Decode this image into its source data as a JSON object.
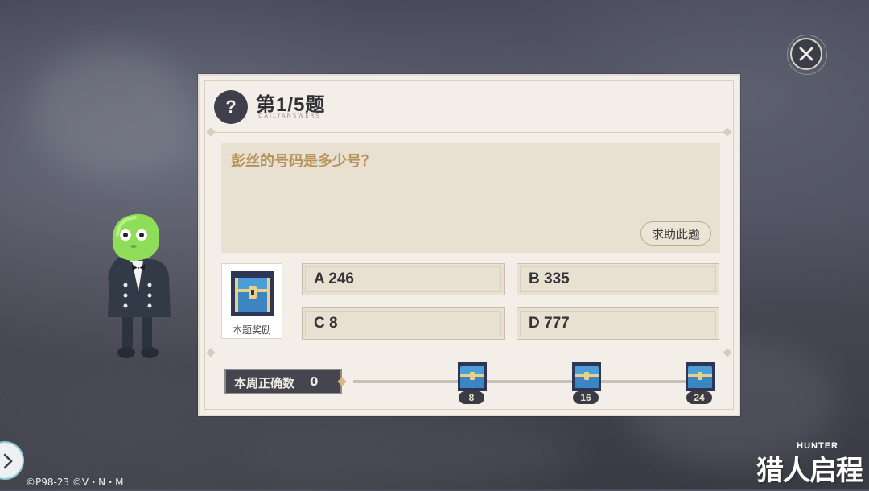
{
  "quiz": {
    "title": "第1/5题",
    "subtitle": "DAILYANSWERS",
    "question": "彭丝的号码是多少号？",
    "help_label": "求助此题",
    "reward_label": "本题奖励",
    "options": [
      {
        "label": "A 246"
      },
      {
        "label": "B 335"
      },
      {
        "label": "C 8"
      },
      {
        "label": "D 777"
      }
    ]
  },
  "progress": {
    "label": "本周正确数",
    "count": "0",
    "milestones": [
      {
        "value": "8"
      },
      {
        "value": "16"
      },
      {
        "value": "24"
      }
    ]
  },
  "footer": {
    "copyright": "©P98-23 ©V・N・M",
    "logo_en": "HUNTER",
    "logo_cn": "猎人启程"
  },
  "icons": {
    "close": "close-icon",
    "question": "question-mark-icon",
    "arrow": "chevron-right-icon",
    "chest": "treasure-chest-icon"
  },
  "colors": {
    "panel_bg": "#f3efe8",
    "question_text": "#b89258",
    "dark": "#3e3f4a"
  }
}
